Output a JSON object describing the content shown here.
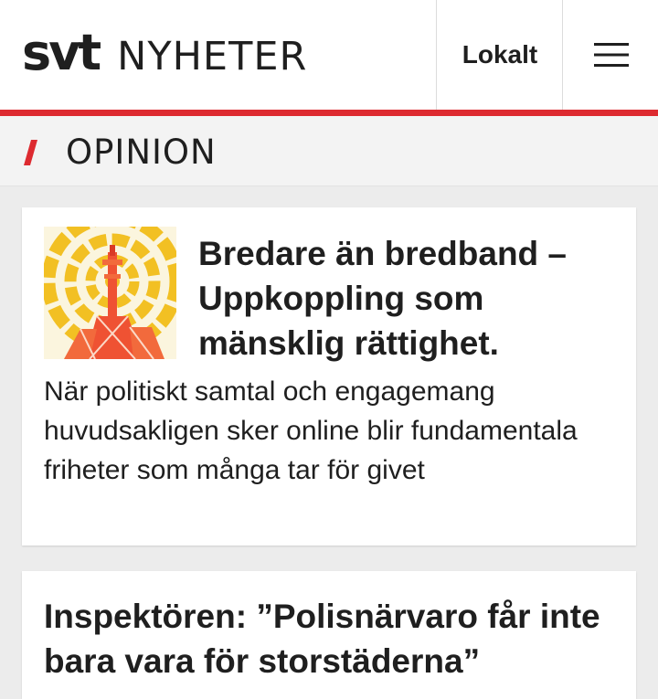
{
  "header": {
    "logo_svt": "svt",
    "logo_nyheter": "NYHETER",
    "lokalt_label": "Lokalt",
    "menu_icon": "hamburger-menu-icon",
    "accent_color": "#dd2a30"
  },
  "section": {
    "title": "OPINION",
    "marker_icon": "red-slash-icon"
  },
  "articles": [
    {
      "headline": "Bredare än bredband – Uppkoppling som mänsklig rättighet.",
      "lead": "När politiskt samtal och engagemang huvudsakligen sker online blir fundamentala friheter som många tar för givet",
      "thumbnail": "radio-tower-illustration"
    },
    {
      "headline": "Inspektören: ”Polisnärvaro får inte bara vara för storstäderna”"
    }
  ]
}
